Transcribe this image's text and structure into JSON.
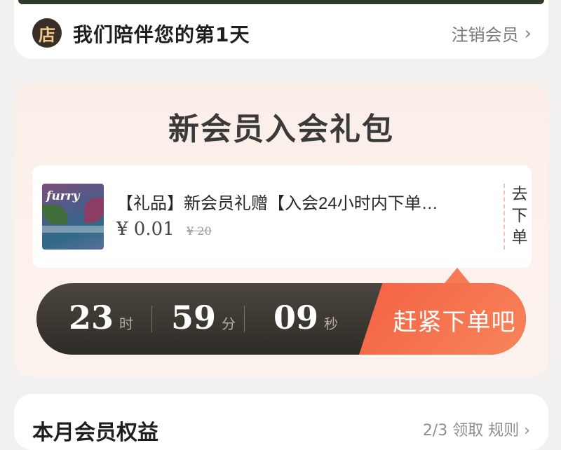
{
  "membership": {
    "store_icon_char": "店",
    "companion_text": "我们陪伴您的第1天",
    "cancel_label": "注销会员",
    "chevron": "›"
  },
  "gift_pack": {
    "title": "新会员入会礼包",
    "product": {
      "brand": "furry",
      "name": "【礼品】新会员礼赠【入会24小时内下单…",
      "price": "¥ 0.01",
      "original_price": "¥ 20"
    },
    "go_order_label": "去下单",
    "countdown": {
      "hours": "23",
      "hours_unit": "时",
      "minutes": "59",
      "minutes_unit": "分",
      "seconds": "09",
      "seconds_unit": "秒"
    },
    "hurry_button": "赶紧下单吧"
  },
  "benefits": {
    "title": "本月会员权益",
    "right_text": "2/3 领取 规则 ›"
  },
  "colors": {
    "accent_orange": "#f36244",
    "countdown_dark": "#2f2b26"
  }
}
